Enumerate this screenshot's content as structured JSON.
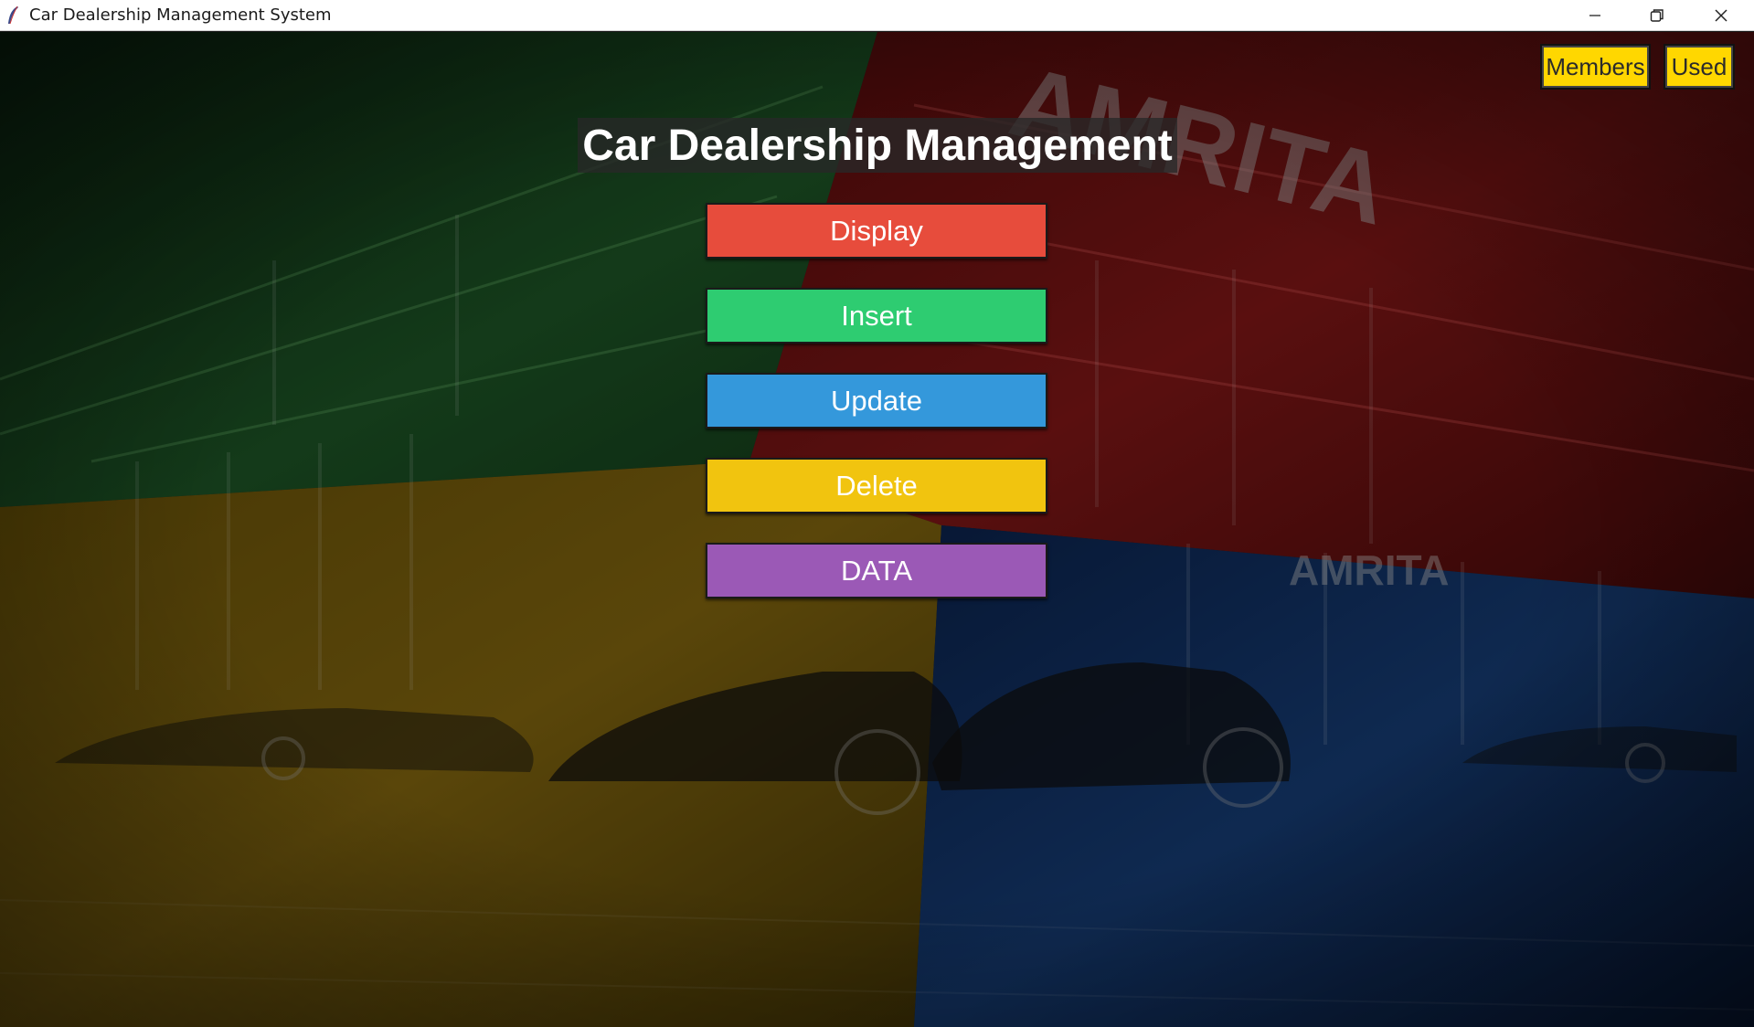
{
  "window": {
    "title": "Car Dealership Management System",
    "controls": [
      "minimize-icon",
      "restore-icon",
      "close-icon"
    ]
  },
  "background": {
    "description_icons": [
      "showroom-image"
    ],
    "signage_text": "AMRITA",
    "quadrant_colors": {
      "top_left": "#1f6b2c",
      "top_right": "#8a1414",
      "bottom_left": "#9a7a10",
      "bottom_right": "#15407a"
    }
  },
  "top_buttons": {
    "members_label": "Members",
    "used_label": "Used",
    "color": "#ffd700"
  },
  "main": {
    "heading": "Car Dealership Management",
    "buttons": [
      {
        "label": "Display",
        "color": "#e74c3c"
      },
      {
        "label": "Insert",
        "color": "#2ecc71"
      },
      {
        "label": "Update",
        "color": "#3498db"
      },
      {
        "label": "Delete",
        "color": "#f1c40f"
      },
      {
        "label": "DATA",
        "color": "#9b59b6"
      }
    ]
  }
}
